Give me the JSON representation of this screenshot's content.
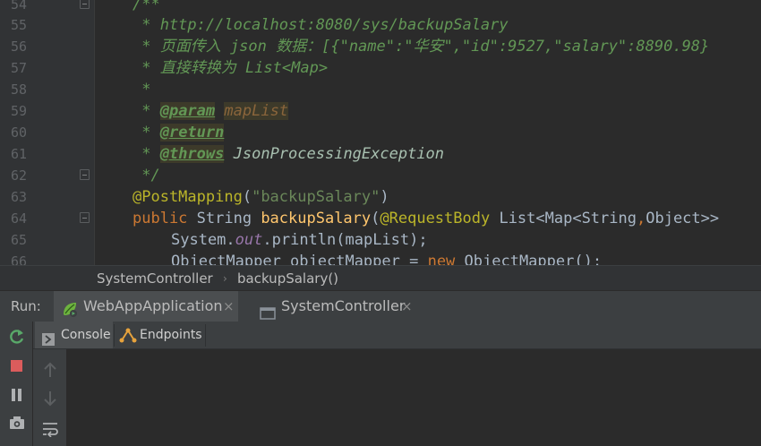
{
  "editor": {
    "lines": [
      {
        "num": "54",
        "text": "/**"
      },
      {
        "num": "55",
        "text": " * http://localhost:8080/sys/backupSalary"
      },
      {
        "num": "56",
        "text": " * 页面传入 json 数据：[{\"name\":\"华安\",\"id\":9527,\"salary\":8890.98}"
      },
      {
        "num": "57",
        "text": " * 直接转换为 List<Map>"
      },
      {
        "num": "58",
        "text": " *"
      },
      {
        "num": "59",
        "text": " * ",
        "tag": "@param",
        "param": "mapList"
      },
      {
        "num": "60",
        "text": " * ",
        "tag": "@return"
      },
      {
        "num": "61",
        "text": " * ",
        "tag": "@throws",
        "exception": "JsonProcessingException"
      },
      {
        "num": "62",
        "text": " */"
      },
      {
        "num": "63",
        "annotation": "@PostMapping",
        "arg": "\"backupSalary\""
      },
      {
        "num": "64",
        "kw": "public",
        "rest1": " String ",
        "method": "backupSalary",
        "rest2": "(",
        "annotation": "@RequestBody",
        "rest3": " List<Map<String",
        "comma": ",",
        "rest4": "Object>>"
      },
      {
        "num": "65",
        "p1": "System.",
        "field": "out",
        "p2": ".println(mapList);"
      },
      {
        "num": "66",
        "p1": "ObjectMapper objectMapper = ",
        "kw": "new",
        "p2": " ObjectMapper();"
      }
    ]
  },
  "breadcrumb": {
    "items": [
      "SystemController",
      "backupSalary()"
    ]
  },
  "run_panel": {
    "label": "Run:",
    "tabs": [
      {
        "label": "WebAppApplication",
        "active": true
      },
      {
        "label": "SystemController",
        "active": false
      }
    ],
    "subtabs": [
      {
        "label": "Console",
        "active": true
      },
      {
        "label": "Endpoints",
        "active": false
      }
    ],
    "close_glyph": "×"
  },
  "colors": {
    "background": "#2b2b2b",
    "comment": "#629755",
    "keyword": "#cc7832",
    "string": "#6a8759",
    "annotation": "#bbb529",
    "method": "#ffc66d"
  },
  "icons": [
    "fold-marker-icon",
    "spring-boot-icon",
    "class-file-icon",
    "rerun-icon",
    "stop-icon",
    "pause-icon",
    "camera-icon",
    "console-icon",
    "endpoints-icon",
    "up-arrow-icon",
    "down-arrow-icon",
    "soft-wrap-icon"
  ]
}
